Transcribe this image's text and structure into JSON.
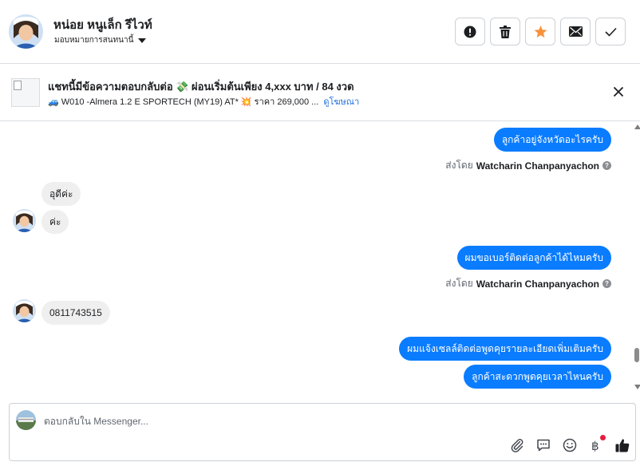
{
  "header": {
    "contact_name": "หน่อย หนูเล็ก รีไวท์",
    "assign_label": "มอบหมายการสนทนานี้",
    "actions": [
      {
        "name": "mark-spam-button",
        "icon": "exclamation-circle-icon"
      },
      {
        "name": "delete-button",
        "icon": "trash-icon"
      },
      {
        "name": "star-button",
        "icon": "star-icon",
        "color": "#f7923b"
      },
      {
        "name": "mark-unread-button",
        "icon": "envelope-icon"
      },
      {
        "name": "mark-done-button",
        "icon": "checkmark-icon"
      }
    ]
  },
  "ad": {
    "title": "แชทนี้มีข้อความตอบกลับต่อ 💸 ผ่อนเริ่มต้นเพียง 4,xxx บาท / 84 งวด",
    "subtitle": "🚙 W010 -Almera 1.2 E SPORTECH (MY19) AT* 💥 ราคา 269,000 ...",
    "link": "ดูโฆษณา"
  },
  "messages": {
    "m1": "ลูกค้าอยู่จังหวัดอะไรครับ",
    "sent_by_1_prefix": "ส่งโดย",
    "sent_by_1_name": "Watcharin Chanpanyachon",
    "m2": "อุดีค่ะ",
    "m3": "ค่ะ",
    "m4": "ผมขอเบอร์ติดต่อลูกค้าได้ไหมครับ",
    "sent_by_2_prefix": "ส่งโดย",
    "sent_by_2_name": "Watcharin Chanpanyachon",
    "m5": "0811743515",
    "m6": "ผมแจ้งเซลล์ติดต่อพูดคุยรายละเอียดเพิ่มเติมครับ",
    "m7": "ลูกค้าสะดวกพูดคุยเวลาไหนครับ"
  },
  "composer": {
    "placeholder": "ตอบกลับใน Messenger...",
    "tools": [
      "paperclip-icon",
      "saved-reply-icon",
      "emoji-icon",
      "baht-payment-icon",
      "thumbs-up-icon"
    ]
  },
  "colors": {
    "outgoing_bubble": "#0a7cff",
    "incoming_bubble": "#efefef",
    "link": "#216fdb",
    "like": "#1c1e21"
  }
}
